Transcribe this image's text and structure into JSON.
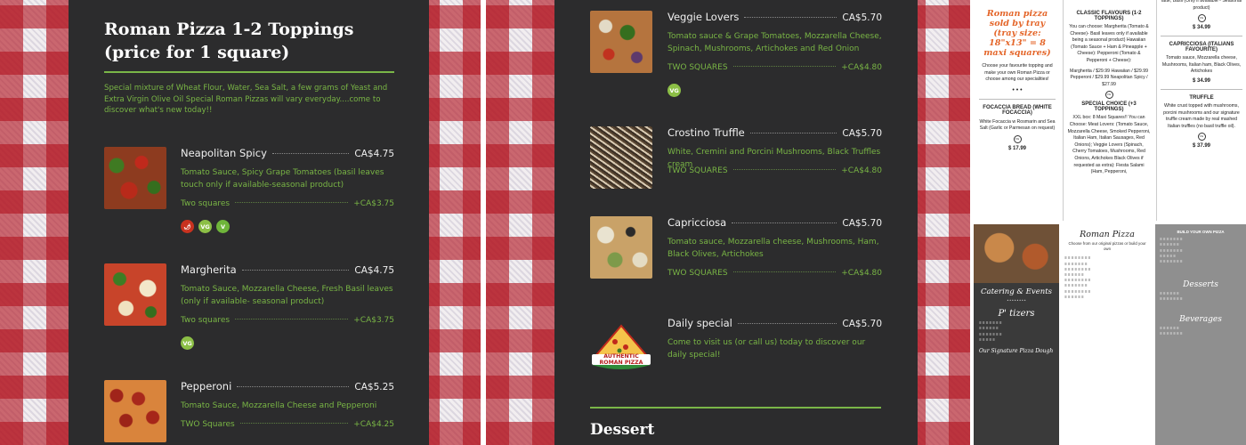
{
  "left_menu": {
    "section_title": "Roman Pizza 1-2 Toppings (price for 1 square)",
    "section_description": "Special mixture of Wheat Flour, Water, Sea Salt, a few grams of Yeast and Extra Virgin Olive Oil Special Roman Pizzas will vary everyday....come to discover what's new today!!",
    "items": [
      {
        "name": "Neapolitan Spicy",
        "price": "CA$4.75",
        "description": "Tomato Sauce, Spicy Grape Tomatoes (basil leaves touch only if available-seasonal product)",
        "option_label": "Two squares",
        "option_price": "+CA$3.75",
        "badges": [
          "spicy",
          "VG",
          "V"
        ]
      },
      {
        "name": "Margherita",
        "price": "CA$4.75",
        "description": "Tomato Sauce, Mozzarella Cheese, Fresh Basil leaves (only if available- seasonal product)",
        "option_label": "Two squares",
        "option_price": "+CA$3.75",
        "badges": [
          "VG"
        ]
      },
      {
        "name": "Pepperoni",
        "price": "CA$5.25",
        "description": "Tomato Sauce, Mozzarella Cheese and Pepperoni",
        "option_label": "TWO Squares",
        "option_price": "+CA$4.25",
        "badges": []
      }
    ]
  },
  "middle_menu": {
    "items": [
      {
        "name": "Veggie Lovers",
        "price": "CA$5.70",
        "description": "Tomato sauce & Grape Tomatoes, Mozzarella Cheese, Spinach, Mushrooms, Artichokes and Red Onion",
        "option_label": "TWO SQUARES",
        "option_price": "+CA$4.80",
        "badges": [
          "VG"
        ]
      },
      {
        "name": "Crostino Truffle",
        "price": "CA$5.70",
        "description": "White, Cremini and Porcini Mushrooms, Black Truffles cream",
        "option_label": "TWO SQUARES",
        "option_price": "+CA$4.80",
        "badges": []
      },
      {
        "name": "Capricciosa",
        "price": "CA$5.70",
        "description": "Tomato sauce, Mozzarella cheese, Mushrooms, Ham, Black Olives, Artichokes",
        "option_label": "TWO SQUARES",
        "option_price": "+CA$4.80",
        "badges": []
      },
      {
        "name": "Daily special",
        "price": "CA$5.70",
        "description": "Come to visit us (or call us) today to discover our daily special!",
        "option_label": "",
        "option_price": "",
        "badges": []
      }
    ],
    "next_section_title": "Dessert",
    "special_logo_text": "AUTHENTIC ROMAN PIZZA"
  },
  "flyer": {
    "headline": "Roman pizza sold by tray (tray size: 18\"x13\" = 8 maxi squares)",
    "intro": "Choose your favourite topping and make your own Roman Pizza or choose among our specialities!",
    "focaccia_title": "FOCACCIA BREAD (WHITE FOCACCIA)",
    "focaccia_text": "White Focaccia w Rosmarin and Sea Salt (Garlic or Parmesan on request)",
    "focaccia_price": "$ 17.99",
    "classic_title": "CLASSIC FLAVOURS (1-2 TOPPINGS)",
    "classic_text": "You can choose: Margherita (Tomato & Cheese)- Basil leaves only if available being a seasonal product) Hawaiian (Tomato Sauce + Ham & Pineapple + Cheese): Pepperoni (Tomato & Pepperoni + Cheese):",
    "classic_prices": "Margherita / $29.99 Hawaiian / $29.99 Pepperoni / $29.99 Neapolitan Spicy / $27.99",
    "special_title": "SPECIAL CHOICE (+3 TOPPINGS)",
    "special_text": "XXL box: 8 Maxi Squares!! You can Choose: Meat Lovers: (Tomato Sauce, Mozzarella Cheese, Smoked Pepperoni, Italian Ham, Italian Sausages, Red Onions); Veggie Lovers (Spinach, Cherry Tomatoes, Mushrooms, Red Onions, Artichokes Black Olives if requested as extra): Fiesta Salami (Ham, Pepperoni,",
    "right_top_text": "latte, Basil (Only if available - Seasonal product)",
    "right_price_1": "$ 34.99",
    "capricciosa_title": "CAPRICCIOSA (ITALIANS FAVOURITE)",
    "capricciosa_text": "Tomato sauce, Mozzarella cheese, Mushrooms, Italian ham, Black Olives, Artichokes",
    "right_price_2": "$ 34.99",
    "truffle_title": "TRUFFLE",
    "truffle_text": "White crust topped with mushrooms, porcini mushrooms and our signature truffle cream made by real mashed Italian truffles (no basil truffle oil).",
    "right_price_3": "$ 37.99"
  },
  "bottom_flyer": {
    "catering_title": "Catering & Events",
    "ptizers_title": "P' tizers",
    "signature_title": "Our Signature Pizza Dough",
    "roman_title": "Roman Pizza",
    "roman_sub": "Choose from our original pizzas or build your own",
    "desserts_title": "Desserts",
    "beverages_title": "Beverages",
    "build_title": "BUILD YOUR OWN PIZZA"
  },
  "colors": {
    "menu_bg": "#2c2c2d",
    "accent_green": "#79b545",
    "gingham_red": "#b21420",
    "flyer_orange": "#e4662a"
  }
}
